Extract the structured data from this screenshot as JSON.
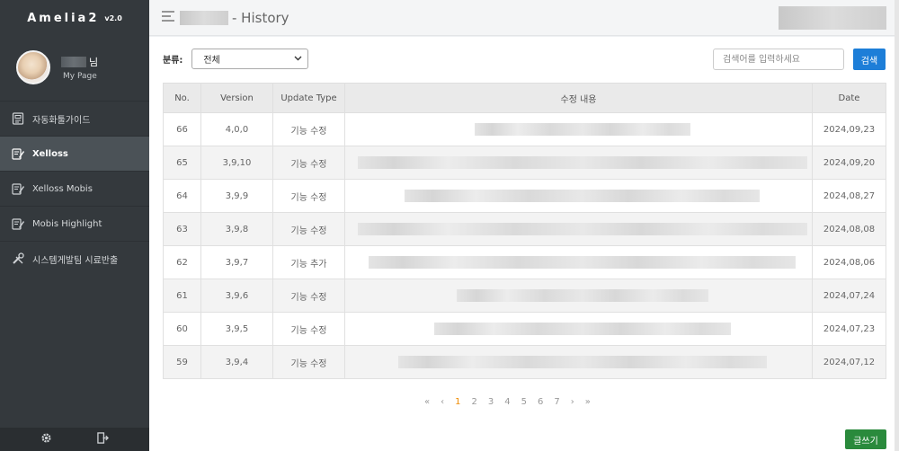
{
  "brand": {
    "name": "Amelia2",
    "version": "v2.0"
  },
  "profile": {
    "suffix": "님",
    "link": "My Page"
  },
  "nav": [
    {
      "label": "자동화툴가이드",
      "icon": "guide-icon",
      "active": false
    },
    {
      "label": "Xelloss",
      "icon": "pen-note-icon",
      "active": true
    },
    {
      "label": "Xelloss Mobis",
      "icon": "pen-note-icon",
      "active": false
    },
    {
      "label": "Mobis Highlight",
      "icon": "pen-note-icon",
      "active": false
    },
    {
      "label": "시스템게발팀 시료반출",
      "icon": "wrench-icon",
      "active": false
    }
  ],
  "header": {
    "title": "- History"
  },
  "filter": {
    "label": "분류:",
    "selected": "전체"
  },
  "search": {
    "placeholder": "검색어를 입력하세요",
    "button": "검색"
  },
  "table": {
    "headers": [
      "No.",
      "Version",
      "Update Type",
      "수정 내용",
      "Date"
    ],
    "rows": [
      {
        "no": "66",
        "version": "4,0,0",
        "type": "기능 수정",
        "date": "2024,09,23",
        "blur": 0.48
      },
      {
        "no": "65",
        "version": "3,9,10",
        "type": "기능 수정",
        "date": "2024,09,20",
        "blur": 1.0
      },
      {
        "no": "64",
        "version": "3,9,9",
        "type": "기능 수정",
        "date": "2024,08,27",
        "blur": 0.79
      },
      {
        "no": "63",
        "version": "3,9,8",
        "type": "기능 수정",
        "date": "2024,08,08",
        "blur": 1.0
      },
      {
        "no": "62",
        "version": "3,9,7",
        "type": "기능 추가",
        "date": "2024,08,06",
        "blur": 0.95
      },
      {
        "no": "61",
        "version": "3,9,6",
        "type": "기능 수정",
        "date": "2024,07,24",
        "blur": 0.56
      },
      {
        "no": "60",
        "version": "3,9,5",
        "type": "기능 수정",
        "date": "2024,07,23",
        "blur": 0.66
      },
      {
        "no": "59",
        "version": "3,9,4",
        "type": "기능 수정",
        "date": "2024,07,12",
        "blur": 0.82
      }
    ]
  },
  "pagination": {
    "first": "«",
    "prev": "‹",
    "pages": [
      "1",
      "2",
      "3",
      "4",
      "5",
      "6",
      "7"
    ],
    "current": "1",
    "next": "›",
    "last": "»"
  },
  "write_button": "글쓰기",
  "footer": {
    "settings_icon": "gear-icon",
    "logout_icon": "logout-icon"
  }
}
